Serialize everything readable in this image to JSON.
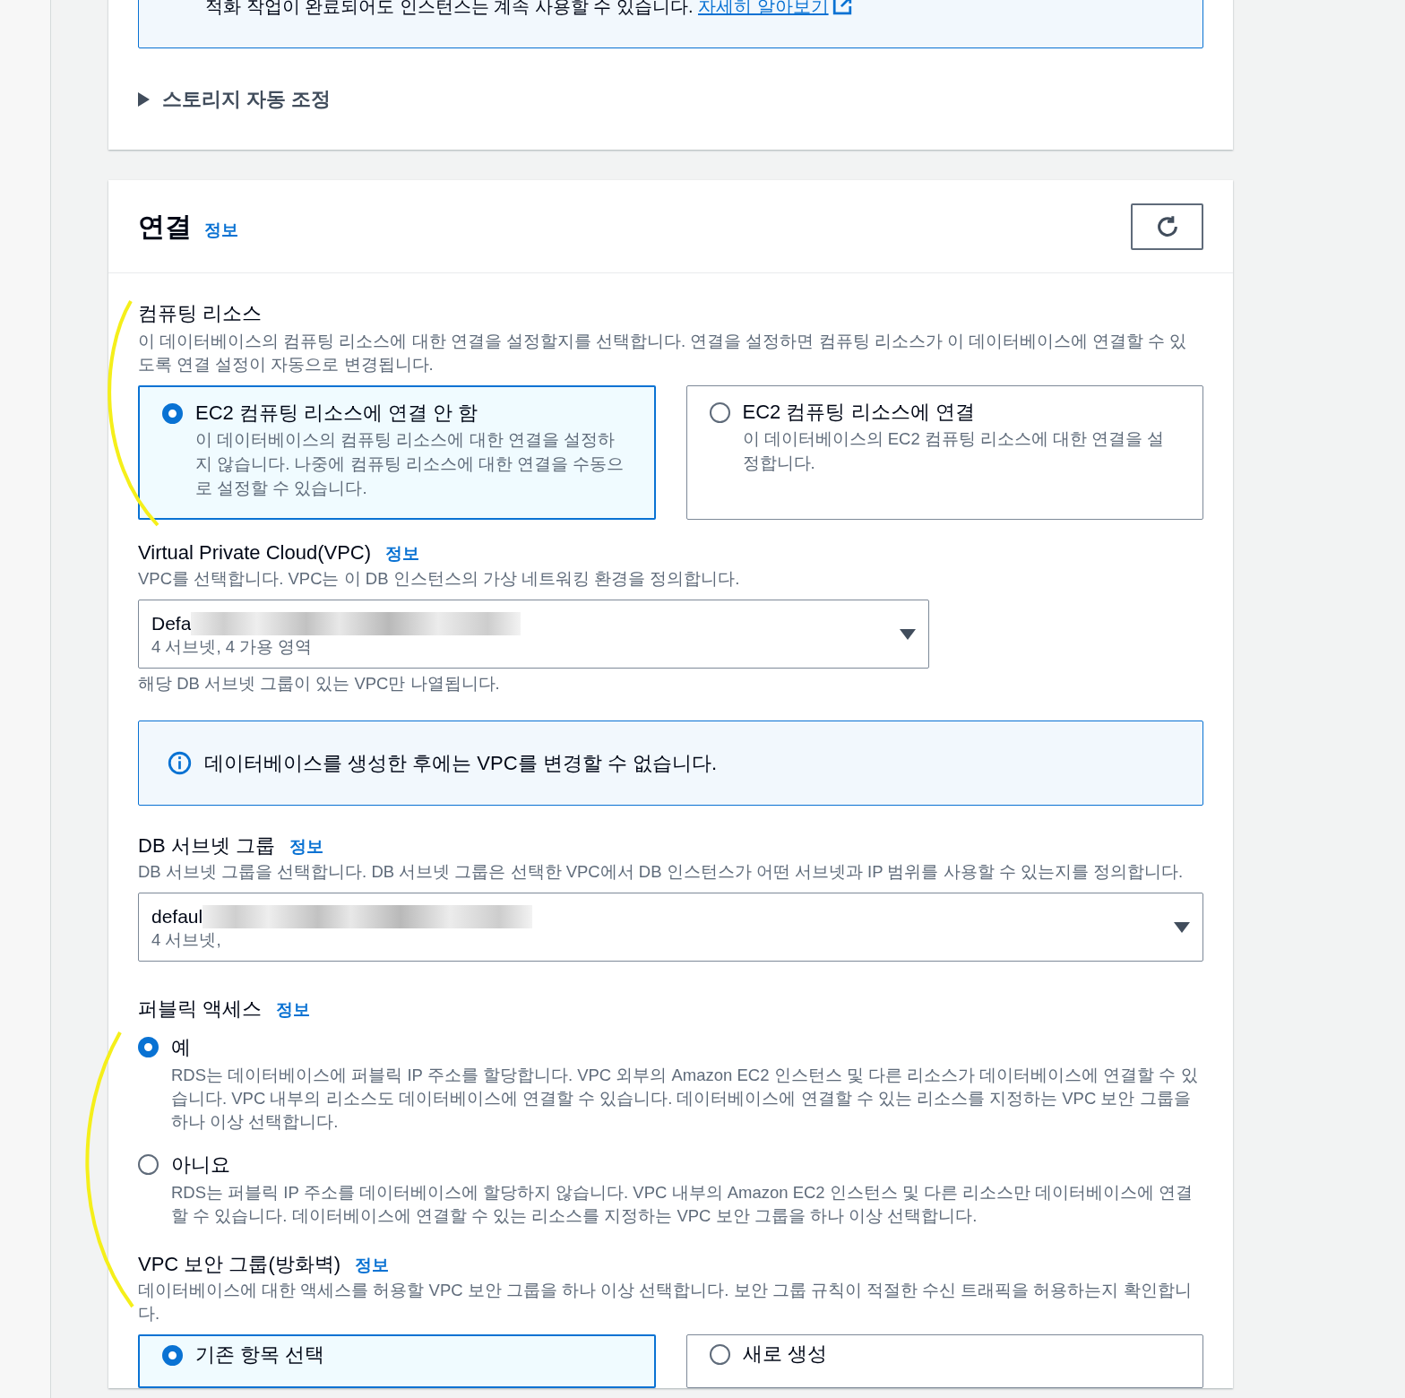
{
  "storage_panel": {
    "notice": {
      "text": "적화 작업이 완료되어도 인스턴스는 계속 사용할 수 있습니다.",
      "link": "자세히 알아보기"
    },
    "expander": {
      "label": "스토리지 자동 조정",
      "expanded": false
    }
  },
  "connectivity": {
    "title": "연결",
    "info": "정보",
    "compute_resource": {
      "label": "컴퓨팅 리소스",
      "description": "이 데이터베이스의 컴퓨팅 리소스에 대한 연결을 설정할지를 선택합니다. 연결을 설정하면 컴퓨팅 리소스가 이 데이터베이스에 연결할 수 있도록 연결 설정이 자동으로 변경됩니다.",
      "options": [
        {
          "label": "EC2 컴퓨팅 리소스에 연결 안 함",
          "description": "이 데이터베이스의 컴퓨팅 리소스에 대한 연결을 설정하지 않습니다. 나중에 컴퓨팅 리소스에 대한 연결을 수동으로 설정할 수 있습니다.",
          "selected": true
        },
        {
          "label": "EC2 컴퓨팅 리소스에 연결",
          "description": "이 데이터베이스의 EC2 컴퓨팅 리소스에 대한 연결을 설정합니다.",
          "selected": false
        }
      ]
    },
    "vpc": {
      "label": "Virtual Private Cloud(VPC)",
      "info": "정보",
      "description": "VPC를 선택합니다. VPC는 이 DB 인스턴스의 가상 네트워킹 환경을 정의합니다.",
      "select": {
        "value": "Defa",
        "detail": "4 서브넷, 4 가용 영역"
      },
      "hint": "해당 DB 서브넷 그룹이 있는 VPC만 나열됩니다."
    },
    "notice": "데이터베이스를 생성한 후에는 VPC를 변경할 수 없습니다.",
    "db_subnet_group": {
      "label": "DB 서브넷 그룹",
      "info": "정보",
      "description": "DB 서브넷 그룹을 선택합니다. DB 서브넷 그룹은 선택한 VPC에서 DB 인스턴스가 어떤 서브넷과 IP 범위를 사용할 수 있는지를 정의합니다.",
      "select": {
        "value": "defaul",
        "detail": "4 서브넷,"
      }
    },
    "public_access": {
      "label": "퍼블릭 액세스",
      "info": "정보",
      "options": [
        {
          "label": "예",
          "description": "RDS는 데이터베이스에 퍼블릭 IP 주소를 할당합니다. VPC 외부의 Amazon EC2 인스턴스 및 다른 리소스가 데이터베이스에 연결할 수 있습니다. VPC 내부의 리소스도 데이터베이스에 연결할 수 있습니다. 데이터베이스에 연결할 수 있는 리소스를 지정하는 VPC 보안 그룹을 하나 이상 선택합니다.",
          "selected": true
        },
        {
          "label": "아니요",
          "description": "RDS는 퍼블릭 IP 주소를 데이터베이스에 할당하지 않습니다. VPC 내부의 Amazon EC2 인스턴스 및 다른 리소스만 데이터베이스에 연결할 수 있습니다. 데이터베이스에 연결할 수 있는 리소스를 지정하는 VPC 보안 그룹을 하나 이상 선택합니다.",
          "selected": false
        }
      ]
    },
    "security_group": {
      "label": "VPC 보안 그룹(방화벽)",
      "info": "정보",
      "description": "데이터베이스에 대한 액세스를 허용할 VPC 보안 그룹을 하나 이상 선택합니다. 보안 그룹 규칙이 적절한 수신 트래픽을 허용하는지 확인합니다.",
      "options": [
        {
          "label": "기존 항목 선택",
          "selected": true
        },
        {
          "label": "새로 생성",
          "selected": false
        }
      ]
    }
  }
}
